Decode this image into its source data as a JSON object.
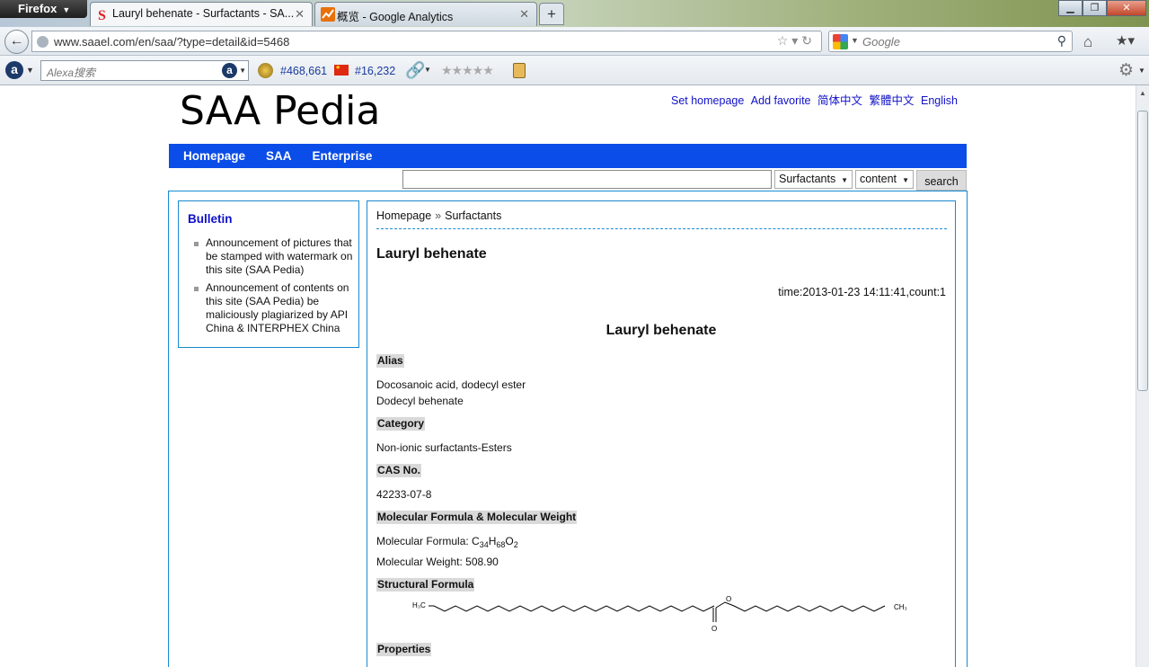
{
  "browser": {
    "menu_label": "Firefox",
    "tabs": [
      {
        "title": "Lauryl behenate - Surfactants - SA...",
        "active": true
      },
      {
        "title": "概览 - Google Analytics",
        "active": false
      }
    ],
    "new_tab": "+",
    "url": "www.saael.com/en/saa/?type=detail&id=5468",
    "search_placeholder": "Google",
    "alexa_placeholder": "Alexa搜索",
    "alexa_global_rank": "#468,661",
    "alexa_china_rank": "#16,232"
  },
  "site": {
    "logo": "SAA Pedia",
    "top_links": [
      "Set homepage",
      "Add favorite",
      "简体中文",
      "繁體中文",
      "English"
    ],
    "nav": [
      "Homepage",
      "SAA",
      "Enterprise"
    ],
    "search": {
      "category_selected": "Surfactants",
      "field_selected": "content",
      "button": "search"
    }
  },
  "bulletin": {
    "title": "Bulletin",
    "items": [
      "Announcement of pictures that be stamped with watermark on this site (SAA Pedia)",
      "Announcement of contents on this site (SAA Pedia) be maliciously plagiarized by API China & INTERPHEX China"
    ]
  },
  "article": {
    "breadcrumb": [
      "Homepage",
      "Surfactants"
    ],
    "breadcrumb_sep": "»",
    "title": "Lauryl behenate",
    "meta": "time:2013-01-23 14:11:41,count:1",
    "center_title": "Lauryl behenate",
    "sections": {
      "alias_h": "Alias",
      "alias": [
        "Docosanoic acid, dodecyl ester",
        "Dodecyl behenate"
      ],
      "category_h": "Category",
      "category": "Non-ionic surfactants-Esters",
      "cas_h": "CAS No.",
      "cas": "42233-07-8",
      "mf_h": "Molecular Formula & Molecular Weight",
      "mf_label": "Molecular Formula: ",
      "mf_parts": [
        "C",
        "34",
        "H",
        "68",
        "O",
        "2"
      ],
      "mw": "Molecular Weight: 508.90",
      "sf_h": "Structural Formula",
      "props_h": "Properties"
    },
    "structure_labels": {
      "left": "H₃C",
      "ester_o": "O",
      "carbonyl_o": "O",
      "right": "CH₃"
    }
  }
}
